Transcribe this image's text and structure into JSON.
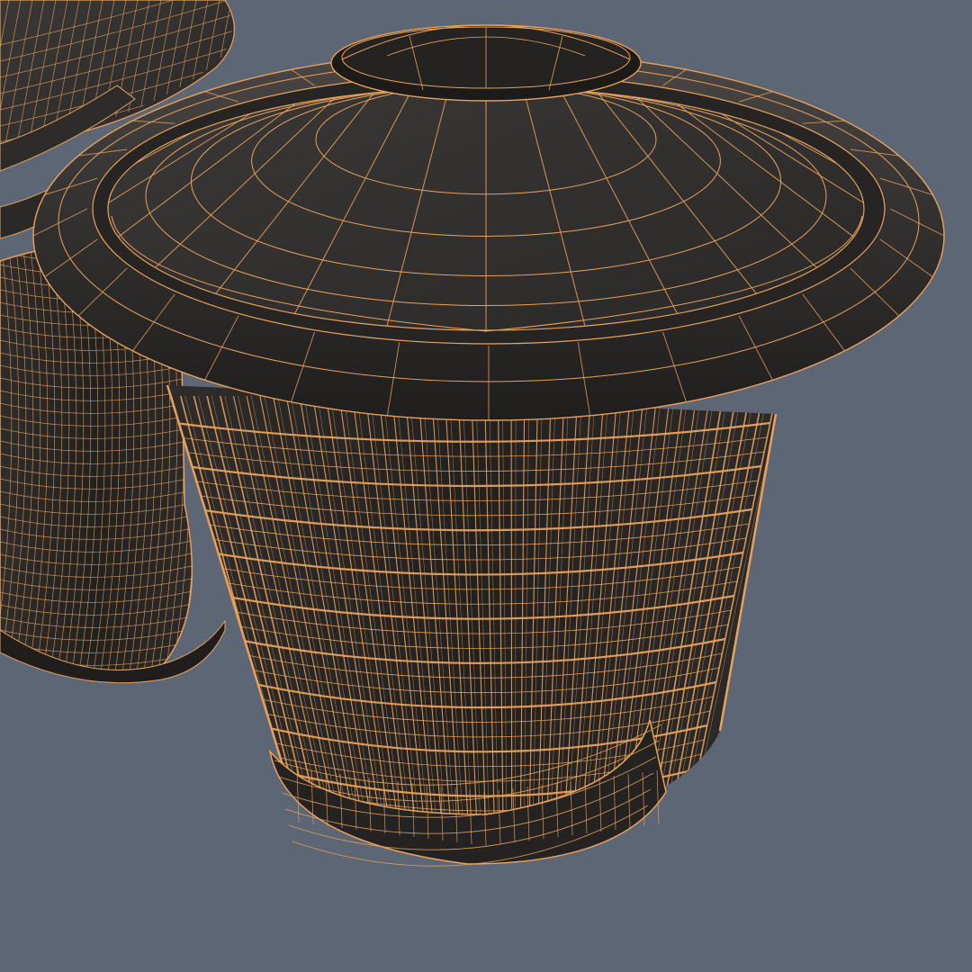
{
  "scene": {
    "subject": "wireframe-render",
    "objects": [
      {
        "name": "trash-can-background",
        "count": 1
      },
      {
        "name": "trash-can-foreground",
        "count": 1
      }
    ]
  },
  "colors": {
    "background": "#5d6674",
    "surface": "#2b2a29",
    "surface_dark": "#1f1e1d",
    "surface_light": "#3d3b39",
    "wire": "#e8a15c",
    "wire_dim": "#b97b44"
  }
}
